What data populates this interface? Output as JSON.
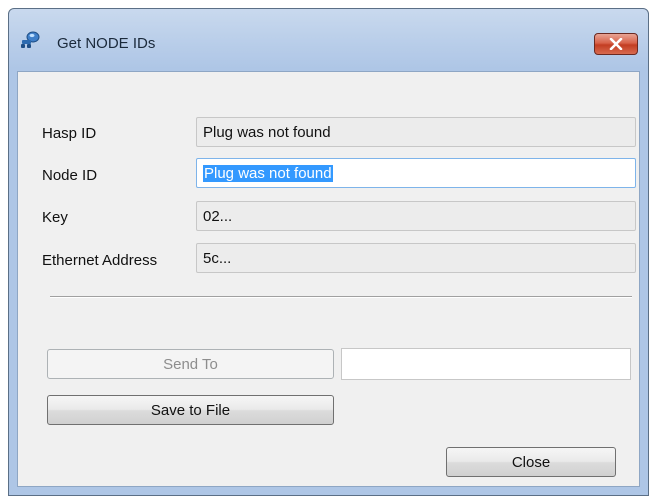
{
  "window": {
    "title": "Get NODE IDs",
    "icon": "network-key-icon",
    "close_icon": "close-x-icon"
  },
  "fields": [
    {
      "label": "Hasp ID",
      "value": "Plug was not found"
    },
    {
      "label": "Node ID",
      "value": "Plug was not found"
    },
    {
      "label": "Key",
      "value": "02..."
    },
    {
      "label": "Ethernet Address",
      "value": "5c..."
    }
  ],
  "buttons": {
    "send_to": "Send To",
    "save_to_file": "Save to File",
    "close": "Close"
  },
  "send_to_input": {
    "value": ""
  },
  "colors": {
    "title_bar": "#b8cde9",
    "client_bg": "#f0f0f0",
    "selection": "#3399ff",
    "close_button": "#c33d22"
  }
}
